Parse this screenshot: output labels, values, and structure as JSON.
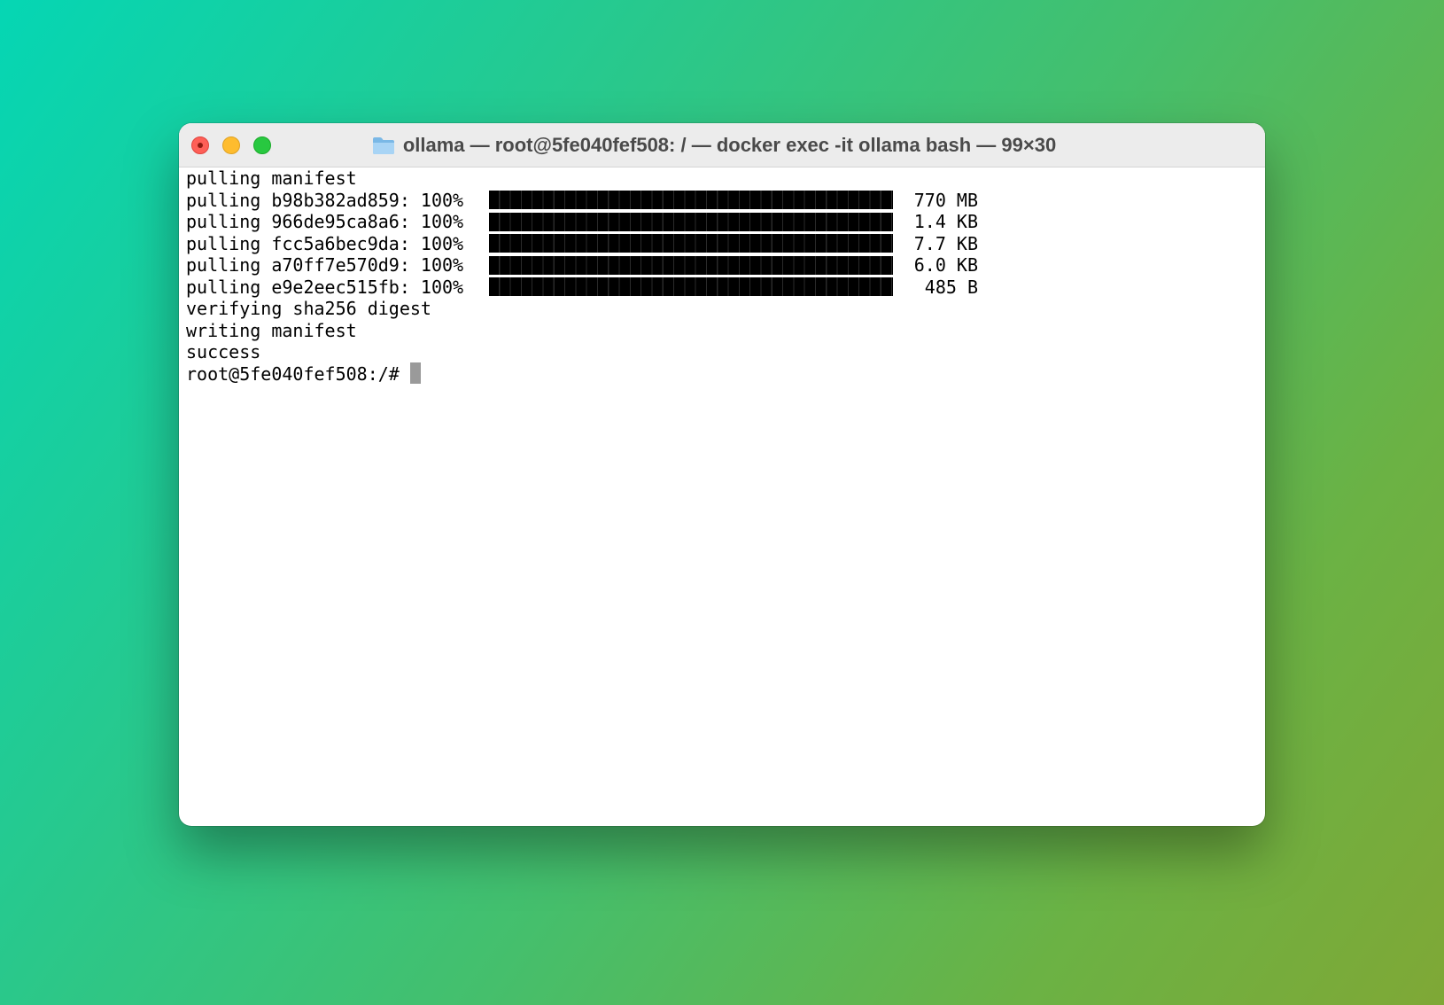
{
  "window": {
    "title": "ollama — root@5fe040fef508: / — docker exec -it ollama bash — 99×30",
    "folder_icon": "folder-icon"
  },
  "terminal": {
    "line_pulling_manifest": "pulling manifest",
    "pulls": [
      {
        "label": "pulling b98b382ad859: 100%",
        "size": "770 MB",
        "progress": 1.0
      },
      {
        "label": "pulling 966de95ca8a6: 100%",
        "size": "1.4 KB",
        "progress": 1.0
      },
      {
        "label": "pulling fcc5a6bec9da: 100%",
        "size": "7.7 KB",
        "progress": 1.0
      },
      {
        "label": "pulling a70ff7e570d9: 100%",
        "size": "6.0 KB",
        "progress": 1.0
      },
      {
        "label": "pulling e9e2eec515fb: 100%",
        "size": "485 B",
        "progress": 1.0
      }
    ],
    "line_verifying": "verifying sha256 digest",
    "line_writing": "writing manifest",
    "line_success": "success",
    "prompt": "root@5fe040fef508:/#"
  },
  "colors": {
    "close": "#fe5f57",
    "minimize": "#febc2e",
    "maximize": "#28c840"
  }
}
